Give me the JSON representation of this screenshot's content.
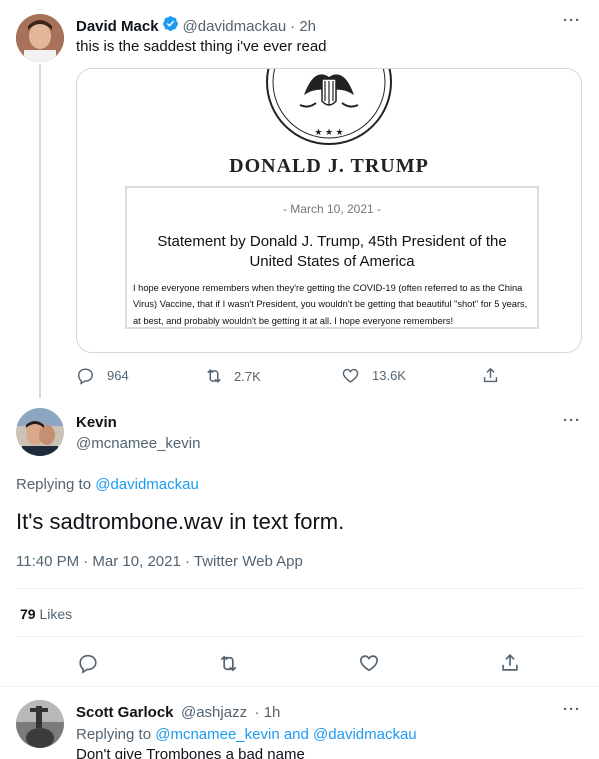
{
  "tweet1": {
    "name": "David Mack",
    "handle": "@davidmackau",
    "time": "· 2h",
    "text": "this is the saddest thing i've ever read",
    "more": "···",
    "image": {
      "heading": "DONALD J. TRUMP",
      "stars": "★ ★ ★",
      "date": "- March 10, 2021 -",
      "title": "Statement by Donald J. Trump, 45th President of the United States of America",
      "body": "I hope everyone remembers when they're getting the COVID-19 (often referred to as the China Virus) Vaccine, that if I wasn't President, you wouldn't be getting that beautiful \"shot\" for 5 years, at best, and probably wouldn't be getting it at all. I hope everyone remembers!"
    },
    "replies": "964",
    "retweets": "2.7K",
    "likes": "13.6K"
  },
  "tweet2": {
    "name": "Kevin",
    "handle": "@mcnamee_kevin",
    "more": "···",
    "replying_prefix": "Replying to",
    "replying_to": "@davidmackau",
    "text": "It's sadtrombone.wav in text form.",
    "meta": "11:40 PM · Mar 10, 2021 · Twitter Web App",
    "likes_count": "79",
    "likes_label": "Likes"
  },
  "tweet3": {
    "name": "Scott Garlock",
    "handle": "@ashjazz",
    "time": "· 1h",
    "more": "···",
    "replying_prefix": "Replying to",
    "replying_to": "@mcnamee_kevin and @davidmackau",
    "text": "Don't give Trombones a bad name"
  },
  "colors": {
    "accent": "#1d9bf0",
    "muted": "#536471",
    "border": "#cfd9de"
  }
}
